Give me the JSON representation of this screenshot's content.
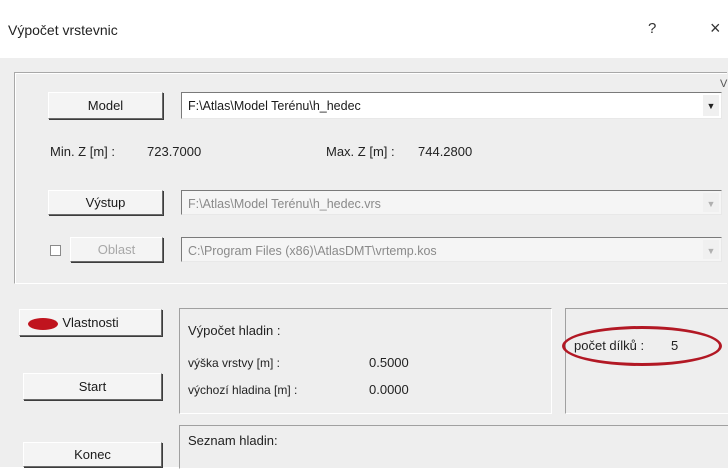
{
  "window": {
    "title": "Výpočet vrstevnic",
    "help_label": "?",
    "close_label": "×"
  },
  "model": {
    "button_label": "Model",
    "path": "F:\\Atlas\\Model Terénu\\h_hedec",
    "min_z_label": "Min. Z [m] :",
    "min_z_value": "723.7000",
    "max_z_label": "Max. Z [m] :",
    "max_z_value": "744.2800"
  },
  "output": {
    "button_label": "Výstup",
    "path": "F:\\Atlas\\Model Terénu\\h_hedec.vrs"
  },
  "area": {
    "button_label": "Oblast",
    "path": "C:\\Program Files (x86)\\AtlasDMT\\vrtemp.kos",
    "checked": false
  },
  "buttons": {
    "properties": "Vlastnosti",
    "start": "Start",
    "end": "Konec"
  },
  "calc": {
    "heading": "Výpočet hladin :",
    "layer_height_label": "výška vrstvy [m] :",
    "layer_height_value": "0.5000",
    "start_level_label": "výchozí hladina [m] :",
    "start_level_value": "0.0000"
  },
  "parts": {
    "label": "počet dílků :",
    "value": "5"
  },
  "levels": {
    "heading": "Seznam hladin:"
  },
  "misc": {
    "corner_text": "V"
  },
  "colors": {
    "highlight_red": "#b21824"
  }
}
